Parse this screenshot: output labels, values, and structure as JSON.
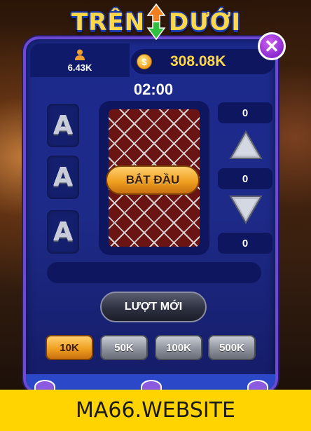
{
  "title": {
    "part1": "TRÊN",
    "part2": "DƯỚI"
  },
  "header": {
    "player_count": "6.43K",
    "balance": "308.08K"
  },
  "timer": "02:00",
  "cards": [
    "A",
    "A",
    "A"
  ],
  "start_button": "BẮT ĐẦU",
  "bets": {
    "upper": "0",
    "middle": "0",
    "lower": "0"
  },
  "new_round_button": "LƯỢT MỚI",
  "chips": [
    {
      "label": "10K",
      "selected": true
    },
    {
      "label": "50K",
      "selected": false
    },
    {
      "label": "100K",
      "selected": false
    },
    {
      "label": "500K",
      "selected": false
    }
  ],
  "banner": "MA66.WEBSITE",
  "icons": {
    "close": "close-icon",
    "player": "user-icon",
    "coin": "coin-icon",
    "up": "arrow-up-icon",
    "down": "arrow-down-icon",
    "title_arrow": "up-down-arrow-icon"
  },
  "colors": {
    "panel": "#1c2a8e",
    "border": "#6b4bd6",
    "gold": "#ffd84a",
    "banner": "#ffd400"
  }
}
